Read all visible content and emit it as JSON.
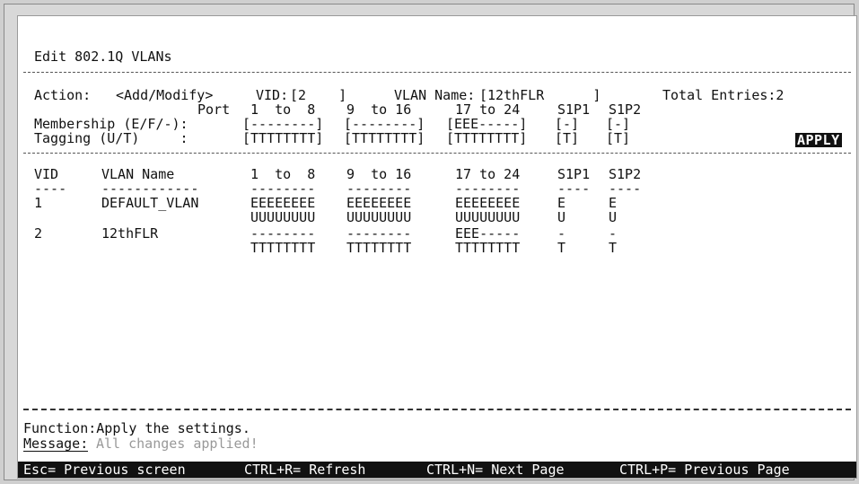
{
  "page": {
    "title": "Edit 802.1Q VLANs"
  },
  "form": {
    "action_label": "Action:",
    "action_value": "<Add/Modify>",
    "vid_label": "VID:",
    "vid_value": "[2    ]",
    "vlan_name_label": "VLAN Name:",
    "vlan_name_value": "[12thFLR      ]",
    "total_entries": "Total Entries:2",
    "port_label": "Port",
    "port_ranges": [
      "1  to  8",
      "9  to 16",
      "17 to 24",
      "S1P1",
      "S1P2"
    ],
    "membership_label": "Membership (E/F/-):",
    "membership_fields": [
      "[--------]",
      "[--------]",
      "[EEE-----]",
      "[-]",
      "[-]"
    ],
    "tagging_label": "Tagging (U/T)     :",
    "tagging_fields": [
      "[TTTTTTTT]",
      "[TTTTTTTT]",
      "[TTTTTTTT]",
      "[T]",
      "[T]"
    ],
    "apply_label": "APPLY"
  },
  "table": {
    "headers": [
      "VID",
      "VLAN Name",
      "1  to  8",
      "9  to 16",
      "17 to 24",
      "S1P1",
      "S1P2"
    ],
    "separators": [
      "----",
      "------------",
      "--------",
      "--------",
      "--------",
      "----",
      "----"
    ],
    "rows": [
      {
        "vid": "1",
        "name": "DEFAULT_VLAN",
        "membership": [
          "EEEEEEEE",
          "EEEEEEEE",
          "EEEEEEEE",
          "E",
          "E"
        ],
        "tagging": [
          "UUUUUUUU",
          "UUUUUUUU",
          "UUUUUUUU",
          "U",
          "U"
        ]
      },
      {
        "vid": "2",
        "name": "12thFLR",
        "membership": [
          "--------",
          "--------",
          "EEE-----",
          "-",
          "-"
        ],
        "tagging": [
          "TTTTTTTT",
          "TTTTTTTT",
          "TTTTTTTT",
          "T",
          "T"
        ]
      }
    ]
  },
  "status": {
    "function": "Function:Apply the settings.",
    "message_label": "Message:",
    "message_text": "All changes applied!"
  },
  "footer": {
    "keys": [
      "Esc= Previous screen",
      "CTRL+R= Refresh",
      "CTRL+N= Next Page",
      "CTRL+P= Previous Page"
    ]
  }
}
